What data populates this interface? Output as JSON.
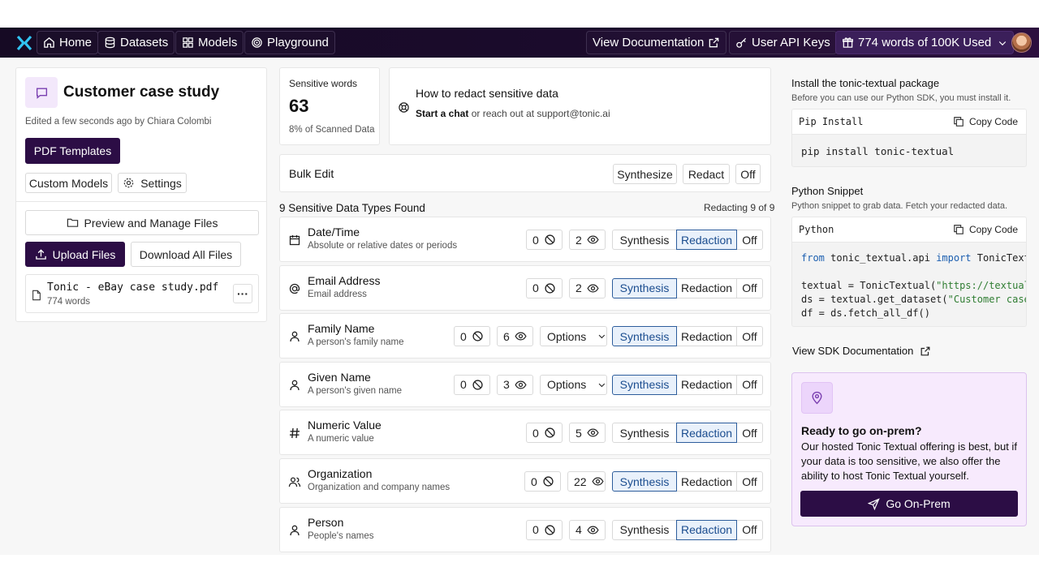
{
  "nav": {
    "home": "Home",
    "datasets": "Datasets",
    "models": "Models",
    "playground": "Playground",
    "view_docs": "View Documentation",
    "api_keys": "User API Keys",
    "usage": "774 words of 100K Used"
  },
  "project": {
    "title": "Customer case study",
    "edited": "Edited a few seconds ago by Chiara Colombi",
    "pdf_templates": "PDF Templates",
    "custom_models": "Custom Models",
    "settings": "Settings",
    "preview_files": "Preview and Manage Files",
    "upload_files": "Upload Files",
    "download_all": "Download All Files",
    "file": {
      "name": "Tonic - eBay case study.pdf",
      "words": "774 words"
    }
  },
  "stats": {
    "label": "Sensitive words",
    "value": "63",
    "sub": "8% of Scanned Data"
  },
  "help": {
    "title": "How to redact sensitive data",
    "link": "Start a chat",
    "rest": "or reach out at support@tonic.ai"
  },
  "bulk": {
    "label": "Bulk Edit",
    "synthesize": "Synthesize",
    "redact": "Redact",
    "off": "Off"
  },
  "types_header": {
    "found": "9 Sensitive Data Types Found",
    "redacting": "Redacting 9 of 9"
  },
  "modes": {
    "synthesis": "Synthesis",
    "redaction": "Redaction",
    "off": "Off",
    "options": "Options"
  },
  "types": [
    {
      "name": "Date/Time",
      "desc": "Absolute or relative dates or periods",
      "icon": "calendar-icon",
      "blocked": "0",
      "visible": "2",
      "mode": "redaction",
      "options": false
    },
    {
      "name": "Email Address",
      "desc": "Email address",
      "icon": "at-sign-icon",
      "blocked": "0",
      "visible": "2",
      "mode": "synthesis",
      "options": false
    },
    {
      "name": "Family Name",
      "desc": "A person's family name",
      "icon": "person-icon",
      "blocked": "0",
      "visible": "6",
      "mode": "synthesis",
      "options": true
    },
    {
      "name": "Given Name",
      "desc": "A person's given name",
      "icon": "person-icon",
      "blocked": "0",
      "visible": "3",
      "mode": "synthesis",
      "options": true
    },
    {
      "name": "Numeric Value",
      "desc": "A numeric value",
      "icon": "hash-icon",
      "blocked": "0",
      "visible": "5",
      "mode": "redaction",
      "options": false
    },
    {
      "name": "Organization",
      "desc": "Organization and company names",
      "icon": "people-icon",
      "blocked": "0",
      "visible": "22",
      "mode": "synthesis",
      "options": false
    },
    {
      "name": "Person",
      "desc": "People's names",
      "icon": "person-icon",
      "blocked": "0",
      "visible": "4",
      "mode": "redaction",
      "options": false
    }
  ],
  "sdk": {
    "install_title": "Install the tonic-textual package",
    "install_sub": "Before you can use our Python SDK, you must install it.",
    "pip_label": "Pip Install",
    "copy": "Copy Code",
    "pip_cmd": "pip install tonic-textual",
    "snippet_title": "Python Snippet",
    "snippet_sub": "Python snippet to grab data. Fetch your redacted data.",
    "py_label": "Python",
    "code": {
      "l1_kw1": "from",
      "l1_mod": " tonic_textual.api ",
      "l1_kw2": "import",
      "l1_cls": " TonicTextual",
      "l2_a": "textual = TonicTextual(",
      "l2_str": "\"https://textual.tonic.ai\"",
      "l3_a": "ds = textual.get_dataset(",
      "l3_str": "\"Customer case study\"",
      "l4": "df = ds.fetch_all_df()"
    },
    "docs_link": "View SDK Documentation"
  },
  "onprem": {
    "title": "Ready to go on-prem?",
    "body": "Our hosted Tonic Textual offering is best, but if your data is too sensitive, we also offer the ability to host Tonic Textual yourself.",
    "button": "Go On-Prem"
  }
}
